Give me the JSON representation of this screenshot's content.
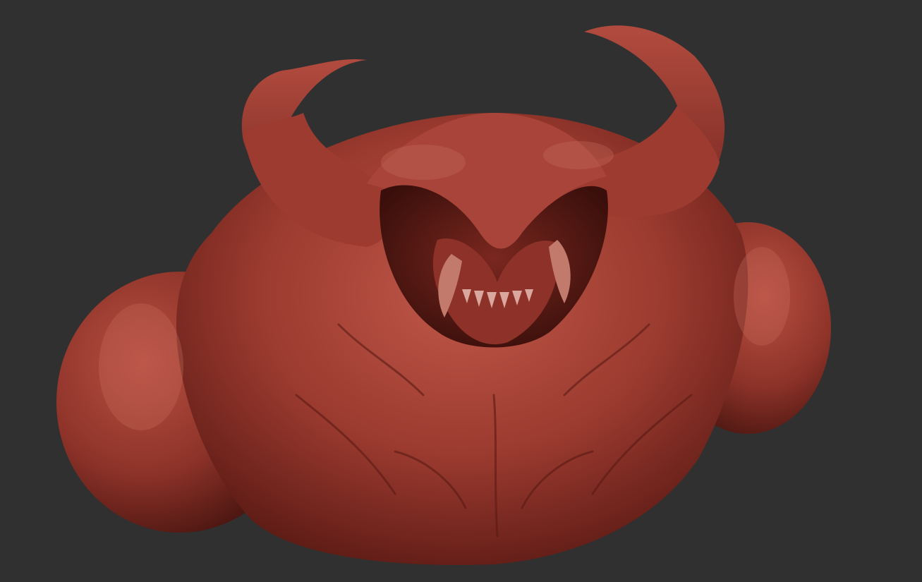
{
  "viewport": {
    "background_color": "#303030"
  },
  "sculpt": {
    "subject": "demon-bust-clay-render",
    "material_color": "#9b3a2f",
    "highlight_color": "#c0584a",
    "shadow_color": "#4a1410"
  }
}
